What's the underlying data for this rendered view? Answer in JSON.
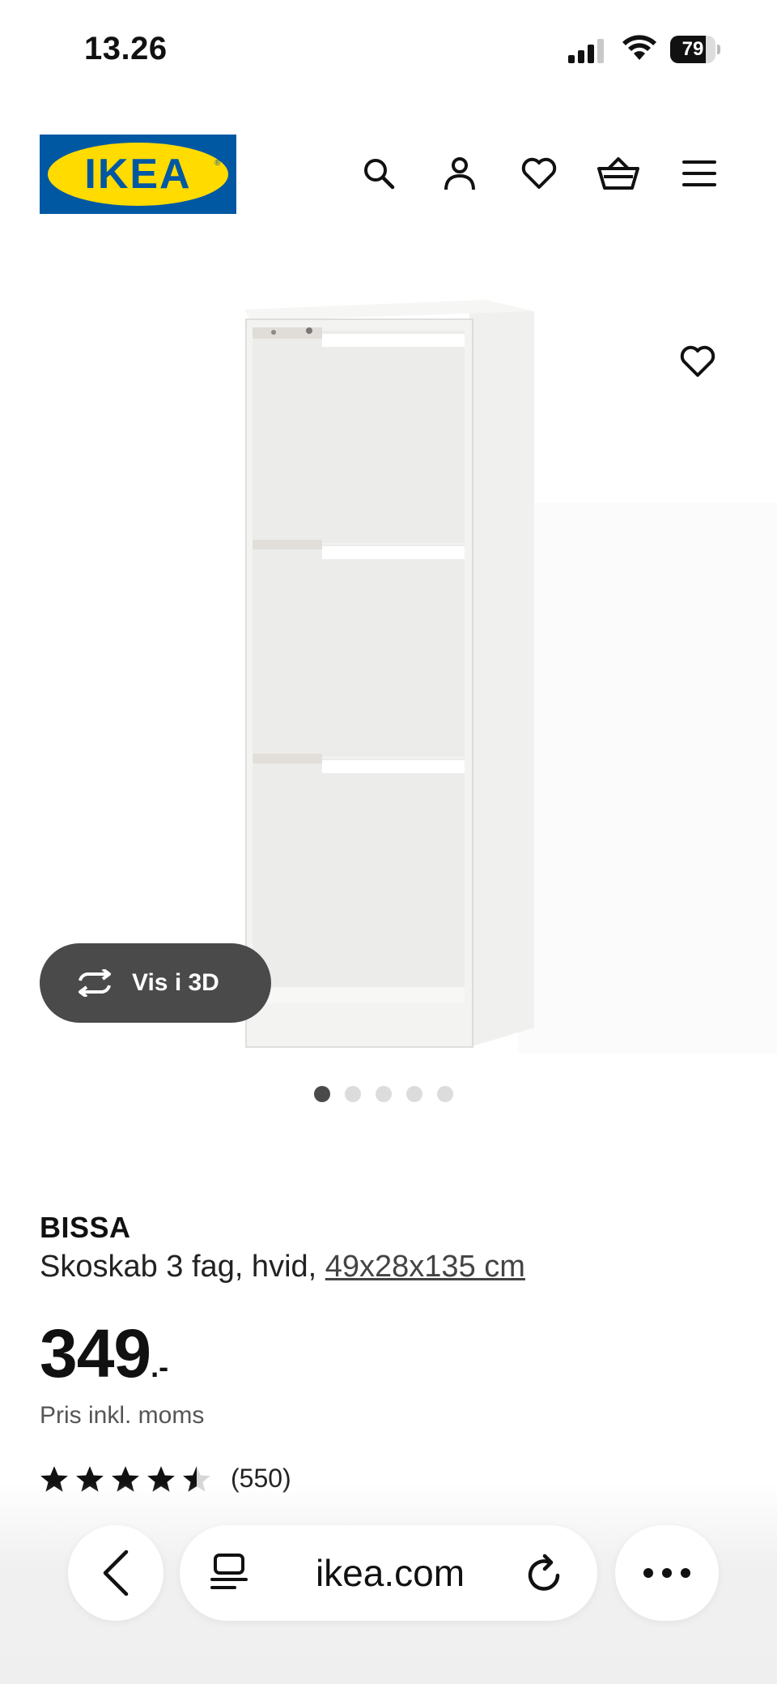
{
  "status_bar": {
    "time": "13.26",
    "battery": "79",
    "battery_level": 0.79
  },
  "header": {
    "logo_text": "IKEA",
    "icons": [
      "search-icon",
      "account-icon",
      "favorites-heart-icon",
      "shopping-basket-icon",
      "menu-icon"
    ]
  },
  "gallery": {
    "view_3d_label": "Vis i 3D",
    "image_count": 5,
    "active_index": 0
  },
  "product": {
    "name": "BISSA",
    "description": "Skoskab 3 fag, hvid, ",
    "dimensions": "49x28x135 cm",
    "price_integer": "349",
    "price_suffix": ".-",
    "vat_note": "Pris inkl. moms",
    "rating": 4.5,
    "review_count": "(550)"
  },
  "browser": {
    "url": "ikea.com"
  },
  "colors": {
    "ikea_blue": "#0058a3",
    "ikea_yellow": "#ffdb00",
    "pill_dark": "#4a4a4a"
  }
}
